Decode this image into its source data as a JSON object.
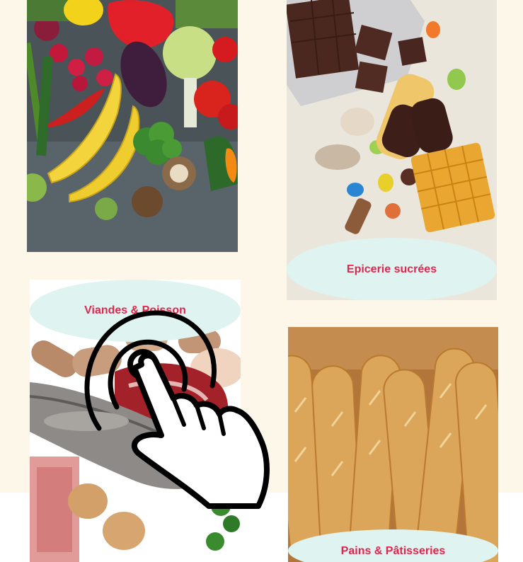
{
  "categories": [
    {
      "id": "fruits-legumes",
      "label": ""
    },
    {
      "id": "epicerie-sucree",
      "label": "Epicerie sucrées"
    },
    {
      "id": "viandes-poisson",
      "label": "Viandes & Poisson"
    },
    {
      "id": "pains-patisseries",
      "label": "Pains & Pâtisseries"
    }
  ],
  "colors": {
    "page_background": "#fdf7ea",
    "label_pill": "#dff3f0",
    "label_text": "#e0264e"
  },
  "icons": {
    "tap_gesture": "hand-tap-icon"
  }
}
